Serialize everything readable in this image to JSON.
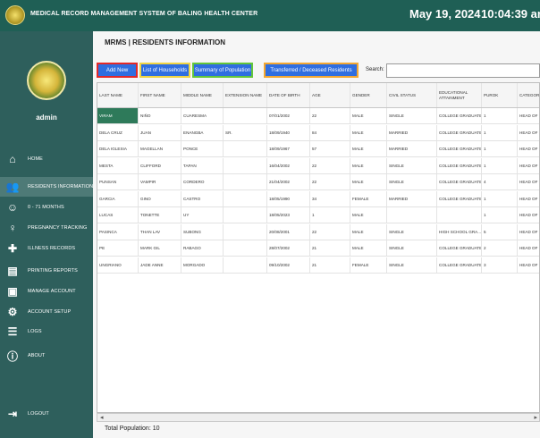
{
  "window": {
    "title": "MEDICAL RECORD MANAGEMENT SYSTEM OF BALING HEALTH CENTER",
    "date": "May 19, 2024",
    "time": "10:04:39 am"
  },
  "sidebar": {
    "username": "admin",
    "items": [
      {
        "label": "HOME",
        "icon": "home-icon"
      },
      {
        "label": "RESIDENTS INFORMATION",
        "icon": "residents-icon"
      },
      {
        "label": "0 - 71 MONTHS",
        "icon": "children-icon"
      },
      {
        "label": "PREGNANCY TRACKING",
        "icon": "pregnancy-icon"
      },
      {
        "label": "ILLNESS RECORDS",
        "icon": "illness-icon"
      },
      {
        "label": "PRINTING REPORTS",
        "icon": "printer-icon"
      },
      {
        "label": "MANAGE ACCOUNT",
        "icon": "account-icon"
      },
      {
        "label": "ACCOUNT SETUP",
        "icon": "setup-icon"
      },
      {
        "label": "LOGS",
        "icon": "logs-icon"
      },
      {
        "label": "ABOUT",
        "icon": "info-icon"
      },
      {
        "label": "LOGOUT",
        "icon": "logout-icon"
      }
    ],
    "active_index": 1
  },
  "main": {
    "subheader": "MRMS | RESIDENTS INFORMATION",
    "buttons": {
      "add_new": "Add New",
      "list_households": "List of Households",
      "summary_population": "Summary of Population",
      "transferred_deceased": "Transferred / Deceased Residents"
    },
    "search": {
      "label": "Search:",
      "value": ""
    },
    "table": {
      "columns": [
        "LAST NAME",
        "FIRST NAME",
        "MIDDLE NAME",
        "EXTENSION NAME",
        "DATE OF BIRTH",
        "AGE",
        "GENDER",
        "CIVIL STATUS",
        "EDUCATIONAL ATTAINMENT",
        "PUROK",
        "CATEGORY"
      ],
      "rows": [
        [
          "VIRAM",
          "NIÑO",
          "CUARESMA",
          "",
          "07/01/2002",
          "22",
          "MALE",
          "SINGLE",
          "COLLEGE GRADUATE",
          "1",
          "HEAD OF"
        ],
        [
          "DELA CRUZ",
          "JUAN",
          "ENANGBA",
          "SR.",
          "18/09/1940",
          "84",
          "MALE",
          "MARRIED",
          "COLLEGE GRADUATE",
          "1",
          "HEAD OF"
        ],
        [
          "DELA IGLESIA",
          "MAGELLAN",
          "PONCE",
          "",
          "18/09/1967",
          "57",
          "MALE",
          "MARRIED",
          "COLLEGE GRADUATE",
          "1",
          "HEAD OF"
        ],
        [
          "MESTA",
          "CLIFFORD",
          "TAPAN",
          "",
          "16/04/2002",
          "22",
          "MALE",
          "SINGLE",
          "COLLEGE GRADUATE",
          "1",
          "HEAD OF"
        ],
        [
          "PUNSAN",
          "VAMPIR",
          "CORDERO",
          "",
          "21/04/2002",
          "22",
          "MALE",
          "SINGLE",
          "COLLEGE GRADUATE",
          "4",
          "HEAD OF"
        ],
        [
          "GARCIA",
          "GINO",
          "CASTRO",
          "",
          "18/05/1990",
          "34",
          "FEMALE",
          "MARRIED",
          "COLLEGE GRADUATE",
          "1",
          "HEAD OF"
        ],
        [
          "LUCAS",
          "TONETTE",
          "UY",
          "",
          "18/05/2023",
          "1",
          "MALE",
          "",
          "",
          "1",
          "HEAD OF"
        ],
        [
          "PASINCA",
          "THAN LAV",
          "SUBONG",
          "",
          "20/08/2001",
          "22",
          "MALE",
          "SINGLE",
          "HIGH SCHOOL GRA...",
          "5",
          "HEAD OF"
        ],
        [
          "PE",
          "MARK GIL",
          "RABAGO",
          "",
          "28/07/2002",
          "21",
          "MALE",
          "SINGLE",
          "COLLEGE GRADUATE",
          "2",
          "HEAD OF"
        ],
        [
          "UNGRIANO",
          "JADE ANNE",
          "MORGADO",
          "",
          "09/10/2002",
          "21",
          "FEMALE",
          "SINGLE",
          "COLLEGE GRADUATE",
          "3",
          "HEAD OF"
        ]
      ]
    },
    "footer": {
      "label": "Total Population:",
      "count": "10"
    }
  },
  "colors": {
    "titlebar": "#1f5f55",
    "sidebar": "#2e5f5c",
    "button_blue": "#2f6ee0",
    "outline_red": "#e32929",
    "outline_yellow": "#f0d443",
    "outline_green": "#63c63a",
    "outline_orange": "#f3a732",
    "selected_cell": "#2e7a5a"
  }
}
